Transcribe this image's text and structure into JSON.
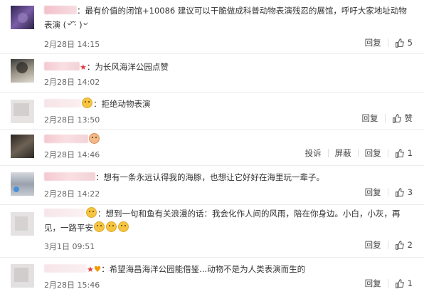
{
  "comments": [
    {
      "text": "：最有价值的闭馆+10086 建议可以干脆做成科普动物表演残忍的展馆，呼吁大家地址动物表演",
      "kaomoji": "(৺ ̆·̆ )৺",
      "time": "2月28日 14:15",
      "reply": "回复",
      "likes": "5"
    },
    {
      "text": "：为长风海洋公园点赞",
      "time": "2月28日 14:02"
    },
    {
      "text": "：拒绝动物表演",
      "time": "2月28日 13:50",
      "reply": "回复",
      "likes": "赞"
    },
    {
      "text": "",
      "time": "2月28日 14:46",
      "report": "投诉",
      "block": "屏蔽",
      "reply": "回复",
      "likes": "1"
    },
    {
      "text": "：想有一条永远认得我的海豚，也想让它好好在海里玩一辈子。",
      "time": "2月28日 14:22",
      "reply": "回复",
      "likes": "3"
    },
    {
      "text": "：想到一句和鱼有关浪漫的话：我会化作人间的风雨，陪在你身边。小白，小灰，再见，一路平安",
      "time": "3月1日 09:51",
      "reply": "回复",
      "likes": "2"
    },
    {
      "text": "：希望海昌海洋公园能借鉴...动物不是为人类表演而生的",
      "time": "2月28日 15:46",
      "reply": "回复",
      "likes": "1"
    }
  ]
}
